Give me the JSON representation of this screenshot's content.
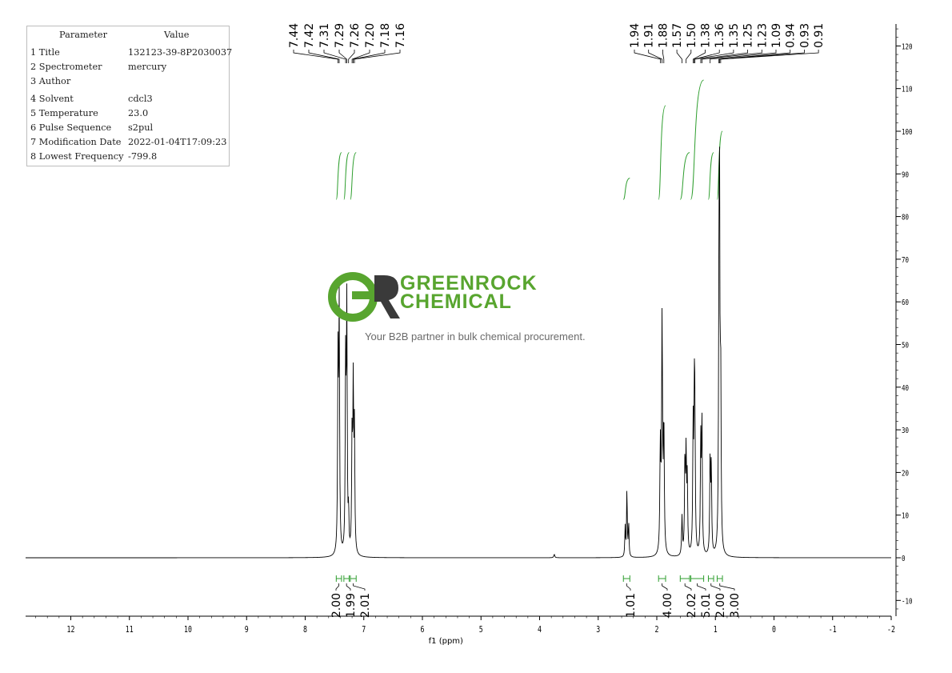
{
  "parameters": {
    "header": {
      "param": "Parameter",
      "value": "Value"
    },
    "rows": [
      {
        "label": "1 Title",
        "value": "132123-39-8P2030037"
      },
      {
        "label": "2 Spectrometer",
        "value": "mercury"
      },
      {
        "label": "3 Author",
        "value": ""
      },
      {
        "label": "4 Solvent",
        "value": "cdcl3"
      },
      {
        "label": "5 Temperature",
        "value": "23.0"
      },
      {
        "label": "6 Pulse Sequence",
        "value": "s2pul"
      },
      {
        "label": "7 Modification Date",
        "value": "2022-01-04T17:09:23"
      },
      {
        "label": "8 Lowest Frequency",
        "value": "-799.8"
      }
    ]
  },
  "watermark": {
    "logo_letters": "GR",
    "brand_line1": "GREENROCK",
    "brand_line2": "CHEMICAL",
    "tagline": "Your B2B partner in bulk chemical procurement.",
    "brand_color": "#58a52f",
    "dark_color": "#3a3a3a"
  },
  "chart_data": {
    "type": "line",
    "xlabel": "f1 (ppm)",
    "xlim": [
      13,
      -2
    ],
    "ylim": [
      -13,
      125
    ],
    "x_ticks": [
      12,
      11,
      10,
      9,
      8,
      7,
      6,
      5,
      4,
      3,
      2,
      1,
      0,
      -1,
      -2
    ],
    "y_ticks": [
      120,
      110,
      100,
      90,
      80,
      70,
      60,
      50,
      40,
      30,
      20,
      10,
      0,
      -10
    ],
    "colors": {
      "spectrum": "#000000",
      "annotation": "#2e9e2e",
      "axis": "#000000"
    },
    "peaks": [
      {
        "ppm": 7.44,
        "height": 45,
        "width": 0.008
      },
      {
        "ppm": 7.42,
        "height": 57,
        "width": 0.008
      },
      {
        "ppm": 7.31,
        "height": 44,
        "width": 0.008
      },
      {
        "ppm": 7.29,
        "height": 57,
        "width": 0.008
      },
      {
        "ppm": 7.26,
        "height": 9,
        "width": 0.006
      },
      {
        "ppm": 7.2,
        "height": 27,
        "width": 0.008
      },
      {
        "ppm": 7.18,
        "height": 38,
        "width": 0.008
      },
      {
        "ppm": 7.16,
        "height": 28,
        "width": 0.008
      },
      {
        "ppm": 3.75,
        "height": 0.8,
        "width": 0.01
      },
      {
        "ppm": 2.54,
        "height": 7,
        "width": 0.007
      },
      {
        "ppm": 2.51,
        "height": 16,
        "width": 0.007
      },
      {
        "ppm": 2.48,
        "height": 8,
        "width": 0.007
      },
      {
        "ppm": 1.94,
        "height": 25,
        "width": 0.009
      },
      {
        "ppm": 1.91,
        "height": 55,
        "width": 0.009
      },
      {
        "ppm": 1.88,
        "height": 30,
        "width": 0.009
      },
      {
        "ppm": 1.57,
        "height": 9,
        "width": 0.008
      },
      {
        "ppm": 1.52,
        "height": 22,
        "width": 0.008
      },
      {
        "ppm": 1.5,
        "height": 23,
        "width": 0.008
      },
      {
        "ppm": 1.48,
        "height": 17,
        "width": 0.008
      },
      {
        "ppm": 1.38,
        "height": 29,
        "width": 0.008
      },
      {
        "ppm": 1.36,
        "height": 31,
        "width": 0.008
      },
      {
        "ppm": 1.35,
        "height": 27,
        "width": 0.008
      },
      {
        "ppm": 1.25,
        "height": 26,
        "width": 0.008
      },
      {
        "ppm": 1.23,
        "height": 31,
        "width": 0.008
      },
      {
        "ppm": 1.09,
        "height": 23,
        "width": 0.008
      },
      {
        "ppm": 1.07,
        "height": 20,
        "width": 0.008
      },
      {
        "ppm": 0.94,
        "height": 44,
        "width": 0.008
      },
      {
        "ppm": 0.93,
        "height": 79,
        "width": 0.008
      },
      {
        "ppm": 0.91,
        "height": 40,
        "width": 0.008
      }
    ],
    "peak_labels_left": [
      "7.44",
      "7.42",
      "7.31",
      "7.29",
      "7.26",
      "7.20",
      "7.18",
      "7.16"
    ],
    "peak_labels_right": [
      "1.94",
      "1.91",
      "1.88",
      "1.57",
      "1.50",
      "1.38",
      "1.36",
      "1.35",
      "1.25",
      "1.23",
      "1.09",
      "0.94",
      "0.93",
      "0.91"
    ],
    "integral_curves": [
      {
        "from": 7.47,
        "to": 7.38,
        "rise": [
          84,
          95
        ]
      },
      {
        "from": 7.34,
        "to": 7.25,
        "rise": [
          84,
          95
        ]
      },
      {
        "from": 7.23,
        "to": 7.13,
        "rise": [
          84,
          95
        ]
      },
      {
        "from": 2.57,
        "to": 2.46,
        "rise": [
          84,
          89
        ]
      },
      {
        "from": 1.97,
        "to": 1.85,
        "rise": [
          84,
          106
        ]
      },
      {
        "from": 1.6,
        "to": 1.44,
        "rise": [
          84,
          95
        ]
      },
      {
        "from": 1.42,
        "to": 1.2,
        "rise": [
          84,
          112
        ]
      },
      {
        "from": 1.12,
        "to": 1.03,
        "rise": [
          84,
          95
        ]
      },
      {
        "from": 0.97,
        "to": 0.88,
        "rise": [
          84,
          100
        ]
      }
    ],
    "integrations": [
      {
        "value": "2.00",
        "from": 7.47,
        "to": 7.38
      },
      {
        "value": "1.99",
        "from": 7.34,
        "to": 7.25
      },
      {
        "value": "2.01",
        "from": 7.23,
        "to": 7.13
      },
      {
        "value": "1.01",
        "from": 2.57,
        "to": 2.46
      },
      {
        "value": "4.00",
        "from": 1.97,
        "to": 1.85
      },
      {
        "value": "2.02",
        "from": 1.6,
        "to": 1.44
      },
      {
        "value": "5.01",
        "from": 1.42,
        "to": 1.2
      },
      {
        "value": "2.00",
        "from": 1.12,
        "to": 1.03
      },
      {
        "value": "3.00",
        "from": 0.97,
        "to": 0.88
      }
    ]
  }
}
